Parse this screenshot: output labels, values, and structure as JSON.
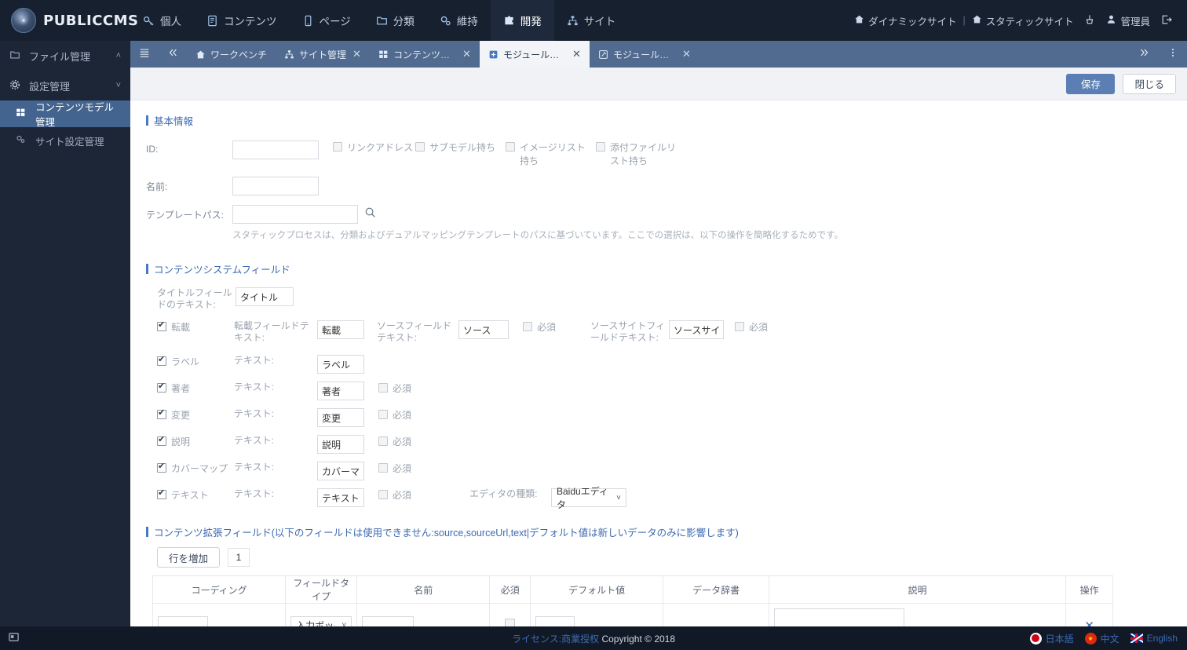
{
  "brand": {
    "name": "PUBLICCMS",
    "logo_icon": "publiccms-logo-icon"
  },
  "topnav": {
    "items": [
      {
        "label": "個人",
        "icon": "key-icon",
        "active": false
      },
      {
        "label": "コンテンツ",
        "icon": "document-icon",
        "active": false
      },
      {
        "label": "ページ",
        "icon": "mobile-icon",
        "active": false
      },
      {
        "label": "分類",
        "icon": "folder-icon",
        "active": false
      },
      {
        "label": "維持",
        "icon": "gears-icon",
        "active": false
      },
      {
        "label": "開発",
        "icon": "puzzle-icon",
        "active": true
      },
      {
        "label": "サイト",
        "icon": "sitemap-icon",
        "active": false
      }
    ],
    "right": {
      "dynamic_site": "ダイナミックサイト",
      "separator": "|",
      "static_site": "スタティックサイト",
      "dynamic_icon": "home-icon",
      "static_icon": "home-icon",
      "cleanup_icon": "broom-icon",
      "user_icon": "user-icon",
      "user_label": "管理員",
      "logout_icon": "logout-icon"
    }
  },
  "sidebar": {
    "groups": [
      {
        "label": "ファイル管理",
        "icon": "folder-open-icon",
        "chevron": "˄",
        "active": false,
        "children": []
      },
      {
        "label": "設定管理",
        "icon": "gear-icon",
        "chevron": "˅",
        "active": false,
        "children": [
          {
            "label": "コンテンツモデル管理",
            "icon": "grid-icon",
            "active": true
          },
          {
            "label": "サイト設定管理",
            "icon": "cogs-icon",
            "active": false
          }
        ]
      }
    ]
  },
  "tabbar": {
    "menu_icon": "list-icon",
    "prev_icon": "chevrons-left-icon",
    "next_icon": "chevrons-right-icon",
    "more_icon": "kebab-menu-icon",
    "tabs": [
      {
        "label": "ワークベンチ",
        "icon": "home-icon",
        "closable": false,
        "active": false
      },
      {
        "label": "サイト管理",
        "icon": "sitemap-icon",
        "closable": true,
        "active": false
      },
      {
        "label": "コンテンツモ...",
        "icon": "grid-icon",
        "closable": true,
        "active": false
      },
      {
        "label": "モジュールを...",
        "icon": "plus-square-icon",
        "closable": true,
        "active": true
      },
      {
        "label": "モジュールを...",
        "icon": "edit-square-icon",
        "closable": true,
        "active": false
      }
    ],
    "close_glyph": "✕"
  },
  "actionbar": {
    "save_label": "保存",
    "close_label": "閉じる"
  },
  "basic": {
    "section_title": "基本情報",
    "id_label": "ID:",
    "id_value": "",
    "name_label": "名前:",
    "name_value": "",
    "template_label": "テンプレートパス:",
    "template_value": "",
    "search_icon": "magnifier-icon",
    "template_hint": "スタティックプロセスは、分類およびデュアルマッピングテンプレートのパスに基づいています。ここでの選択は、以下の操作を簡略化するためです。",
    "checkboxes": [
      {
        "label": "リンクアドレス",
        "checked": false
      },
      {
        "label": "サブモデル持ち",
        "checked": false
      },
      {
        "label": "イメージリスト持ち",
        "checked": false
      },
      {
        "label": "添付ファイルリスト持ち",
        "checked": false
      }
    ]
  },
  "system_fields": {
    "section_title": "コンテンツシステムフィールド",
    "title_row": {
      "label": "タイトルフィールドのテキスト:",
      "value": "タイトル"
    },
    "repost_row": {
      "check_label": "転載",
      "checked": true,
      "field_label": "転載フィールドテキスト:",
      "field_value": "転載",
      "source_label": "ソースフィールドテキスト:",
      "source_value": "ソース",
      "source_required_label": "必須",
      "source_required": false,
      "sourcesite_label": "ソースサイトフィールドテキスト:",
      "sourcesite_value": "ソースサイト",
      "sourcesite_required_label": "必須",
      "sourcesite_required": false
    },
    "text_label": "テキスト:",
    "required_label": "必須",
    "rows": [
      {
        "check_label": "ラベル",
        "checked": true,
        "text_label": "テキスト:",
        "value": "ラベル",
        "has_required": false,
        "required": false
      },
      {
        "check_label": "著者",
        "checked": true,
        "text_label": "テキスト:",
        "value": "著者",
        "has_required": true,
        "required": false
      },
      {
        "check_label": "変更",
        "checked": true,
        "text_label": "テキスト:",
        "value": "変更",
        "has_required": true,
        "required": false
      },
      {
        "check_label": "説明",
        "checked": true,
        "text_label": "テキスト:",
        "value": "説明",
        "has_required": true,
        "required": false
      },
      {
        "check_label": "カバーマップ",
        "checked": true,
        "text_label": "テキスト:",
        "value": "カバーマップ",
        "has_required": true,
        "required": false
      },
      {
        "check_label": "テキスト",
        "checked": true,
        "text_label": "テキスト:",
        "value": "テキスト",
        "has_required": true,
        "required": false
      }
    ],
    "editor": {
      "label": "エディタの種類:",
      "value": "Baiduエディタ",
      "chevron": "˅"
    }
  },
  "extended": {
    "section_title": "コンテンツ拡張フィールド(以下のフィールドは使用できません:source,sourceUrl,text|デフォルト値は新しいデータのみに影響します)",
    "add_row_label": "行を増加",
    "row_count": "1",
    "columns": [
      "コーディング",
      "フィールドタイプ",
      "名前",
      "必須",
      "デフォルト値",
      "データ辞書",
      "説明",
      "操作"
    ],
    "rows": [
      {
        "coding": "",
        "field_type": "入力ボックス",
        "field_type_chevron": "˅",
        "name": "",
        "required": false,
        "default_value": "",
        "dictionary": "",
        "description": "",
        "delete_glyph": "✕"
      }
    ]
  },
  "footer": {
    "left_icon": "window-icon",
    "license_label": "ライセンス:",
    "license_value": "商業授权",
    "copyright": "Copyright © 2018",
    "languages": [
      {
        "label": "日本語",
        "flag": "flag-jp"
      },
      {
        "label": "中文",
        "flag": "flag-cn"
      },
      {
        "label": "English",
        "flag": "flag-uk"
      }
    ]
  },
  "colors": {
    "topnav_bg": "#17202e",
    "sidebar_bg": "#1d2636",
    "tabbar_bg": "#516a8f",
    "accent": "#4878c0",
    "primary_btn": "#5b7fb4",
    "sidebar_active": "#42648e",
    "footer_bg": "#111927"
  }
}
